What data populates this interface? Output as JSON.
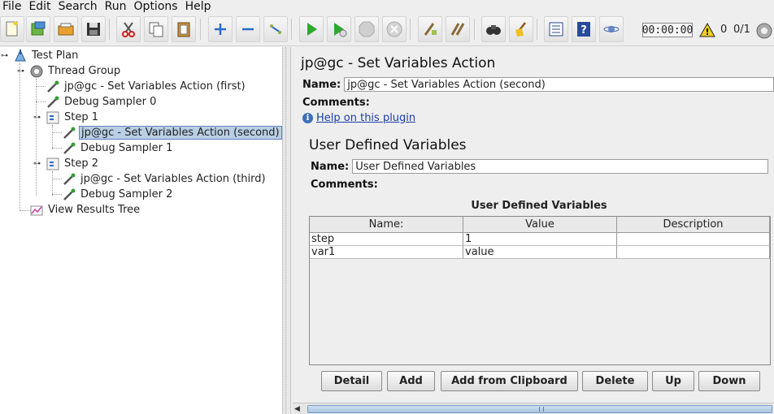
{
  "menu": [
    "File",
    "Edit",
    "Search",
    "Run",
    "Options",
    "Help"
  ],
  "toolbar": {
    "icons": [
      "new-icon",
      "templates-icon",
      "open-icon",
      "save-icon",
      "cut-icon",
      "copy-icon",
      "paste-icon",
      "expand-icon",
      "collapse-icon",
      "toggle-icon",
      "start-icon",
      "start-no-pause-icon",
      "stop-icon",
      "shutdown-icon",
      "clear-icon",
      "clear-all-icon",
      "search-icon",
      "reset-search-icon",
      "function-helper-icon",
      "help-icon",
      "remote-icon"
    ],
    "timer": "00:00:00",
    "warning_count": "0",
    "threads": "0/1"
  },
  "tree": {
    "items": [
      {
        "label": "Test Plan",
        "icon": "test-plan-icon"
      },
      {
        "label": "Thread Group",
        "icon": "gear-icon"
      },
      {
        "label": "jp@gc - Set Variables Action (first)",
        "icon": "sampler-icon"
      },
      {
        "label": "Debug Sampler 0",
        "icon": "sampler-icon"
      },
      {
        "label": "Step 1",
        "icon": "controller-icon"
      },
      {
        "label": "jp@gc - Set Variables Action (second)",
        "icon": "sampler-icon"
      },
      {
        "label": "Debug Sampler 1",
        "icon": "sampler-icon"
      },
      {
        "label": "Step 2",
        "icon": "controller-icon"
      },
      {
        "label": "jp@gc - Set Variables Action (third)",
        "icon": "sampler-icon"
      },
      {
        "label": "Debug Sampler 2",
        "icon": "sampler-icon"
      },
      {
        "label": "View Results Tree",
        "icon": "listener-icon"
      }
    ],
    "selected_index": 5
  },
  "panel": {
    "title": "jp@gc - Set Variables Action",
    "name_label": "Name:",
    "name_value": "jp@gc - Set Variables Action (second)",
    "comments_label": "Comments:",
    "comments_value": "",
    "help_link": "Help on this plugin"
  },
  "udv": {
    "title": "User Defined Variables",
    "name_label": "Name:",
    "name_value": "User Defined Variables",
    "comments_label": "Comments:",
    "comments_value": "",
    "table_caption": "User Defined Variables",
    "columns": [
      "Name:",
      "Value",
      "Description"
    ],
    "rows": [
      [
        "step",
        "1",
        ""
      ],
      [
        "var1",
        "value",
        ""
      ]
    ],
    "buttons": [
      "Detail",
      "Add",
      "Add from Clipboard",
      "Delete",
      "Up",
      "Down"
    ]
  },
  "colors": {
    "selection_bg": "#b8cfe5",
    "selection_border": "#6382bf",
    "link": "#1a3ea8"
  }
}
